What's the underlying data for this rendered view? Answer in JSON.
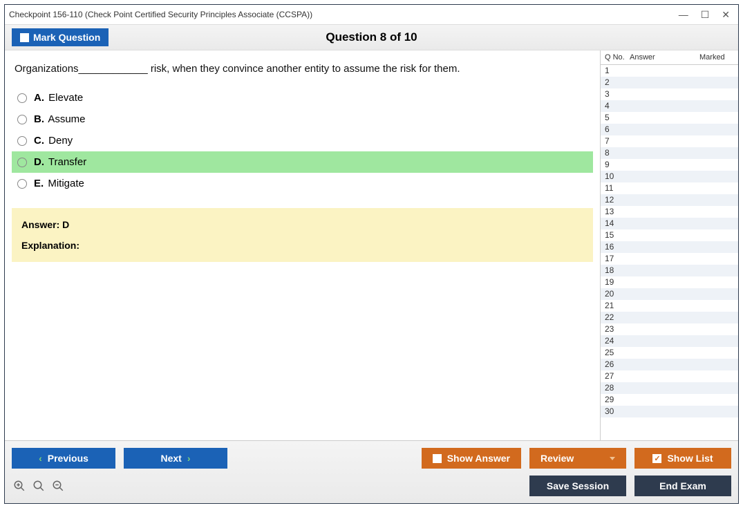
{
  "window": {
    "title": "Checkpoint 156-110 (Check Point Certified Security Principles Associate (CCSPA))"
  },
  "header": {
    "mark_label": "Mark Question",
    "question_counter": "Question 8 of 10"
  },
  "question": {
    "text": "Organizations____________ risk, when they convince another entity to assume the risk for them.",
    "choices": [
      {
        "letter": "A.",
        "text": "Elevate",
        "correct": false
      },
      {
        "letter": "B.",
        "text": "Assume",
        "correct": false
      },
      {
        "letter": "C.",
        "text": "Deny",
        "correct": false
      },
      {
        "letter": "D.",
        "text": "Transfer",
        "correct": true
      },
      {
        "letter": "E.",
        "text": "Mitigate",
        "correct": false
      }
    ],
    "answer_label": "Answer: D",
    "explanation_label": "Explanation:",
    "explanation_text": ""
  },
  "side": {
    "header": {
      "qno": "Q No.",
      "answer": "Answer",
      "marked": "Marked"
    },
    "rows": [
      1,
      2,
      3,
      4,
      5,
      6,
      7,
      8,
      9,
      10,
      11,
      12,
      13,
      14,
      15,
      16,
      17,
      18,
      19,
      20,
      21,
      22,
      23,
      24,
      25,
      26,
      27,
      28,
      29,
      30
    ]
  },
  "footer": {
    "previous": "Previous",
    "next": "Next",
    "show_answer": "Show Answer",
    "review": "Review",
    "show_list": "Show List",
    "save_session": "Save Session",
    "end_exam": "End Exam"
  }
}
